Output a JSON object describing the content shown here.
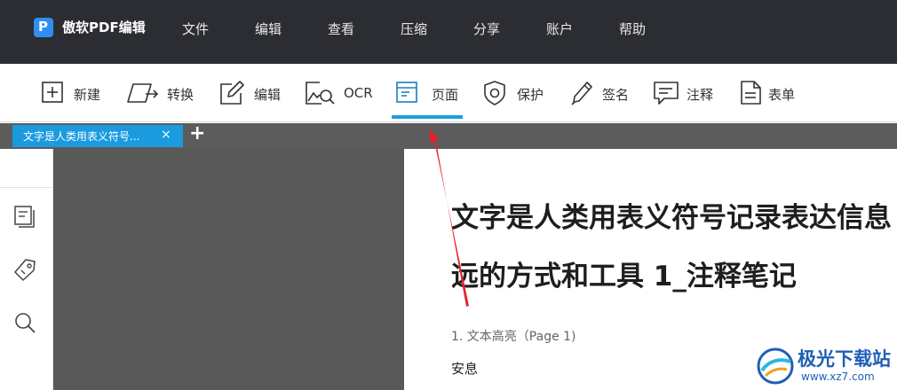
{
  "app": {
    "logo_letter": "P",
    "name": "傲软PDF编辑"
  },
  "menu": [
    "文件",
    "编辑",
    "查看",
    "压缩",
    "分享",
    "账户",
    "帮助"
  ],
  "toolbar": [
    {
      "label": "新建",
      "icon": "plus-square-icon"
    },
    {
      "label": "转换",
      "icon": "convert-icon"
    },
    {
      "label": "编辑",
      "icon": "pencil-square-icon"
    },
    {
      "label": "OCR",
      "icon": "image-search-icon"
    },
    {
      "label": "页面",
      "icon": "page-icon",
      "active": true
    },
    {
      "label": "保护",
      "icon": "shield-icon"
    },
    {
      "label": "签名",
      "icon": "pen-icon"
    },
    {
      "label": "注释",
      "icon": "comment-icon"
    },
    {
      "label": "表单",
      "icon": "form-icon"
    }
  ],
  "tabs": {
    "current_title": "文字是人类用表义符号...",
    "close_glyph": "×",
    "add_glyph": "+"
  },
  "sidebar": [
    "pages-icon",
    "tag-icon",
    "search-icon"
  ],
  "document": {
    "heading_line1": "文字是人类用表义符号记录表达信息",
    "heading_line2": "远的方式和工具 1_注释笔记",
    "annotation_title": "1. 文本高亮（Page 1)",
    "annotation_text": "安息"
  },
  "watermark": {
    "brand": "极光下载站",
    "url": "www.xz7.com"
  },
  "colors": {
    "titlebar": "#2b2d33",
    "accent": "#1aa0de",
    "tab": "#1a9be0",
    "viewer": "#595959",
    "arrow": "#e0242a"
  }
}
